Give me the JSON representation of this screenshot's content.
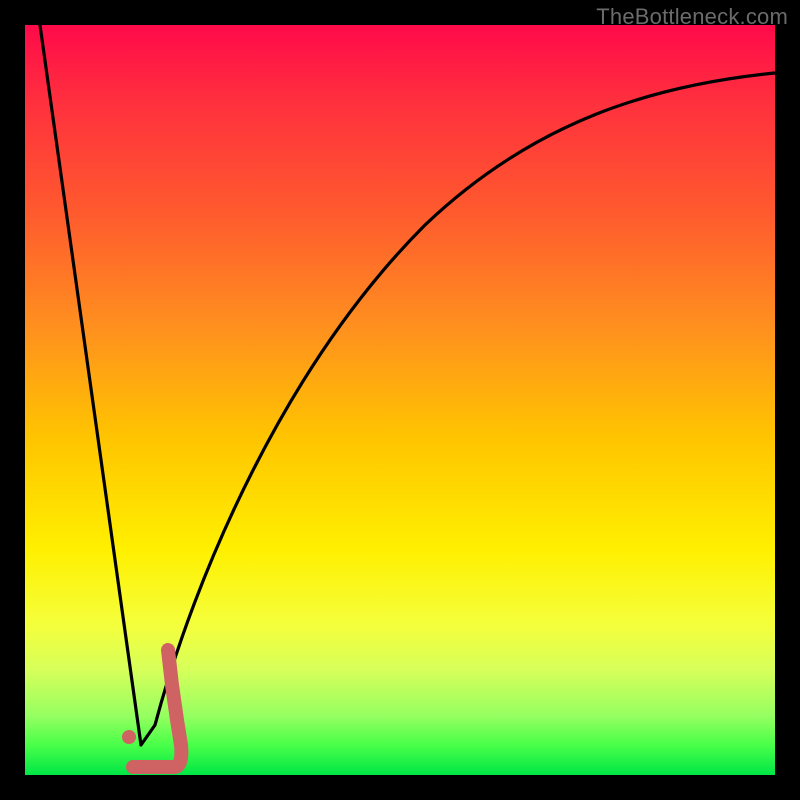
{
  "watermark": "TheBottleneck.com",
  "chart_data": {
    "type": "line",
    "title": "",
    "xlabel": "",
    "ylabel": "",
    "xlim": [
      0,
      100
    ],
    "ylim": [
      0,
      100
    ],
    "grid": false,
    "legend": false,
    "series": [
      {
        "name": "curve",
        "color": "#000000",
        "x": [
          0,
          5,
          10,
          12,
          14,
          15,
          16,
          18,
          20,
          25,
          30,
          35,
          40,
          45,
          50,
          55,
          60,
          65,
          70,
          75,
          80,
          85,
          90,
          95,
          100
        ],
        "values": [
          100,
          70,
          34,
          14,
          2,
          0,
          2,
          8,
          20,
          40,
          54,
          64,
          71,
          76.5,
          80.5,
          83.5,
          86,
          88,
          89.7,
          91,
          92.2,
          93.2,
          94,
          94.6,
          95.1
        ]
      },
      {
        "name": "highlight-tick",
        "color": "#d06464",
        "x": [
          16,
          16.5,
          17,
          17.5,
          18,
          18.5,
          18.5,
          16,
          13.5
        ],
        "values": [
          16,
          12,
          8,
          4,
          1.5,
          0.5,
          0,
          0,
          0
        ]
      }
    ],
    "points": [
      {
        "name": "marker-dot",
        "x": 13,
        "y": 4,
        "color": "#d06464",
        "r": 6
      }
    ]
  }
}
